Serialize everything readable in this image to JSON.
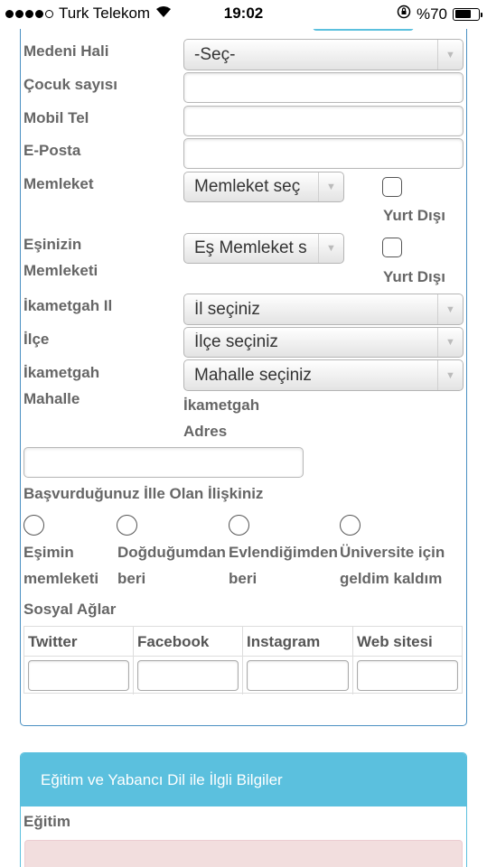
{
  "status_bar": {
    "carrier": "Turk Telekom",
    "time": "19:02",
    "battery": "%70",
    "battery_level": 0.7
  },
  "form": {
    "marital_status": {
      "label": "Medeni Hali",
      "value": "-Seç-"
    },
    "children": {
      "label": "Çocuk sayısı"
    },
    "mobile": {
      "label": "Mobil Tel"
    },
    "email": {
      "label": "E-Posta"
    },
    "hometown": {
      "label": "Memleket",
      "value": "Memleket seç",
      "abroad_label": "Yurt Dışı"
    },
    "spouse_hometown": {
      "label_line1": "Eşinizin",
      "label_line2": "Memleketi",
      "value": "Eş Memleket s",
      "abroad_label": "Yurt Dışı"
    },
    "residence_province": {
      "label": "İkametgah Il",
      "value": "İl seçiniz"
    },
    "district": {
      "label": "İlçe",
      "value": "İlçe seçiniz"
    },
    "residence_neighborhood": {
      "label_line1": "İkametgah",
      "label_line2": "Mahalle",
      "value": "Mahalle seçiniz"
    },
    "residence_address": {
      "label_line1": "İkametgah",
      "label_line2": "Adres"
    },
    "relation": {
      "label": "Başvurduğunuz İlle Olan İlişkiniz",
      "options": [
        {
          "line1": "Eşimin",
          "line2": "memleketi"
        },
        {
          "line1": "Doğduğumdan",
          "line2": "beri"
        },
        {
          "line1": "Evlendiğimden",
          "line2": "beri"
        },
        {
          "line1": "Üniversite için",
          "line2": "geldim kaldım"
        }
      ]
    },
    "social": {
      "label": "Sosyal Ağlar",
      "columns": [
        "Twitter",
        "Facebook",
        "Instagram",
        "Web sitesi"
      ]
    }
  },
  "education_panel": {
    "title": "Eğitim ve Yabancı Dil ile İlgli Bilgiler",
    "education_label": "Eğitim"
  },
  "colors": {
    "panel_border": "#4a90c2",
    "heading_bg": "#5bc0de",
    "alert_bg": "#f2dede"
  }
}
